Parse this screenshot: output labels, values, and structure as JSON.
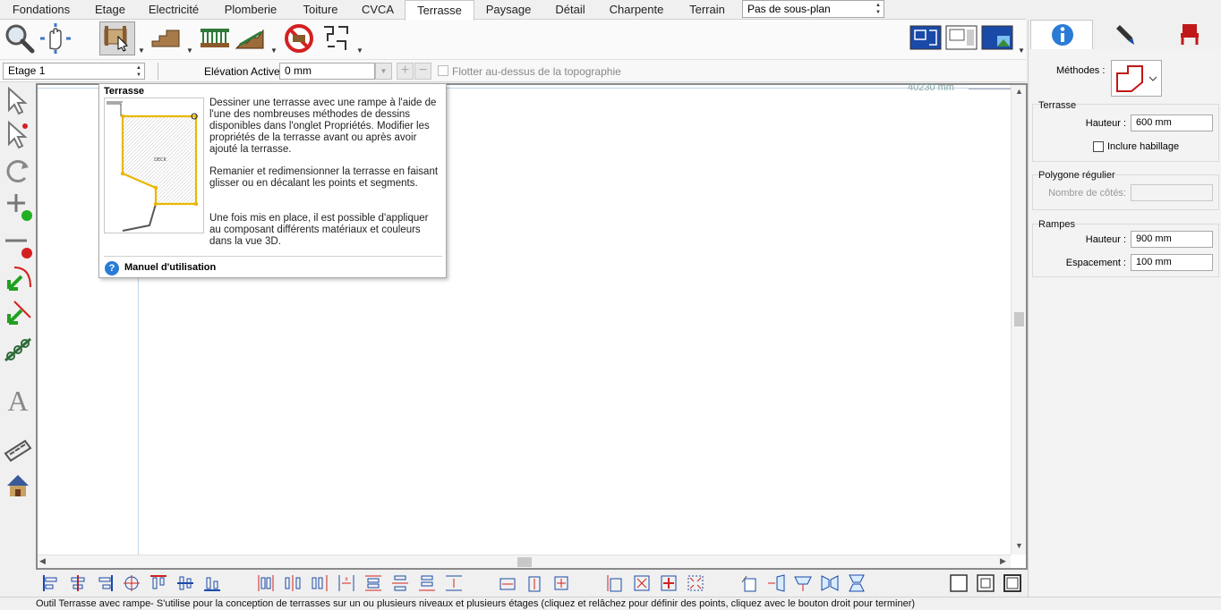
{
  "menu": {
    "tabs": [
      "Fondations",
      "Etage",
      "Electricité",
      "Plomberie",
      "Toiture",
      "CVCA",
      "Terrasse",
      "Paysage",
      "Détail",
      "Charpente",
      "Terrain"
    ],
    "active_tab": "Terrasse",
    "subplan_value": "Pas de sous-plan"
  },
  "optbar": {
    "level_value": "Etage 1",
    "elevation_label": "Elévation Active:",
    "elevation_value": "0 mm",
    "float_label": "Flotter au-dessus de la topographie"
  },
  "canvas": {
    "ruler_value": "40230 mm"
  },
  "tooltip": {
    "title": "Terrasse",
    "thumb_label": "DECK",
    "para1": "Dessiner une terrasse avec une rampe à l'aide de l'une des nombreuses méthodes de dessins disponibles dans l'onglet Propriétés. Modifier les propriétés de la terrasse avant ou après avoir ajouté la terrasse.",
    "para2": "Remanier et redimensionner la terrasse en faisant glisser ou en décalant les points et segments.",
    "para3": "Une fois mis en place, il est possible d'appliquer au composant différents matériaux et couleurs dans la vue 3D.",
    "help_glyph": "?",
    "manual_label": "Manuel d'utilisation"
  },
  "panel": {
    "methods_label": "Méthodes :",
    "terrasse": {
      "title": "Terrasse",
      "height_label": "Hauteur :",
      "height_value": "600 mm",
      "trim_label": "Inclure habillage"
    },
    "polygon": {
      "title": "Polygone régulier",
      "sides_label": "Nombre de côtés:",
      "sides_value": ""
    },
    "rampes": {
      "title": "Rampes",
      "height_label": "Hauteur :",
      "height_value": "900 mm",
      "spacing_label": "Espacement :",
      "spacing_value": "100 mm"
    }
  },
  "status": {
    "text": "Outil Terrasse avec rampe- S'utilise pour la conception de terrasses sur un ou plusieurs niveaux et plusieurs étages (cliquez et relâchez pour définir des points, cliquez avec le bouton droit pour terminer)"
  },
  "colors": {
    "accent_blue": "#2a7bd5",
    "deck_outline": "#e8b800",
    "red_icon": "#d42020",
    "green_icon": "#20b020"
  },
  "icons": {
    "zoom": "magnifier-icon",
    "pan": "hand-pan-icon",
    "deck": "deck-tool-icon",
    "info": "info-icon",
    "pen": "pen-icon",
    "chair": "chair-icon"
  }
}
